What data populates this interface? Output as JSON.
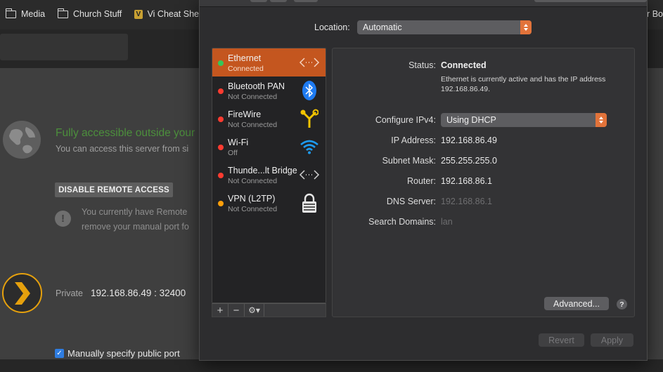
{
  "bookmarks": {
    "items": [
      {
        "label": "Media",
        "icon": "folder-icon"
      },
      {
        "label": "Church Stuff",
        "icon": "folder-icon"
      },
      {
        "label": "Vi Cheat She",
        "icon": "vi-icon"
      }
    ],
    "right_label": "or Bo"
  },
  "plex_page": {
    "remote_title": "Fully accessible outside your",
    "remote_subtitle": "You can access this server from si",
    "disable_button": "DISABLE REMOTE ACCESS",
    "warning_line1": "You currently have Remote",
    "warning_line2": "remove your manual port fo",
    "private_label": "Private",
    "private_value": "192.168.86.49 : 32400",
    "manual_port_label": "Manually specify public port",
    "manual_port_checked": true,
    "accent_color": "#e5a00d",
    "success_color": "#4c8f3c"
  },
  "network": {
    "location_label": "Location:",
    "location_value": "Automatic",
    "services": [
      {
        "name": "Ethernet",
        "status": "Connected",
        "dot": "#34c759",
        "icon": "ethernet-icon",
        "selected": true
      },
      {
        "name": "Bluetooth PAN",
        "status": "Not Connected",
        "dot": "#ff3b30",
        "icon": "bluetooth-icon",
        "selected": false
      },
      {
        "name": "FireWire",
        "status": "Not Connected",
        "dot": "#ff3b30",
        "icon": "firewire-icon",
        "selected": false
      },
      {
        "name": "Wi-Fi",
        "status": "Off",
        "dot": "#ff3b30",
        "icon": "wifi-icon",
        "selected": false
      },
      {
        "name": "Thunde...lt Bridge",
        "status": "Not Connected",
        "dot": "#ff3b30",
        "icon": "thunderbolt-bridge-icon",
        "selected": false
      },
      {
        "name": "VPN (L2TP)",
        "status": "Not Connected",
        "dot": "#ff9f0a",
        "icon": "vpn-lock-icon",
        "selected": false
      }
    ],
    "footer": {
      "add": "+",
      "remove": "−",
      "gear": "⚙▾"
    },
    "detail": {
      "status_label": "Status:",
      "status_value": "Connected",
      "status_description": "Ethernet is currently active and has the IP address 192.168.86.49.",
      "ipv4_label": "Configure IPv4:",
      "ipv4_value": "Using DHCP",
      "ip_label": "IP Address:",
      "ip_value": "192.168.86.49",
      "subnet_label": "Subnet Mask:",
      "subnet_value": "255.255.255.0",
      "router_label": "Router:",
      "router_value": "192.168.86.1",
      "dns_label": "DNS Server:",
      "dns_value": "192.168.86.1",
      "search_label": "Search Domains:",
      "search_value": "lan",
      "advanced_button": "Advanced...",
      "help_button": "?"
    },
    "revert_button": "Revert",
    "apply_button": "Apply",
    "selection_color": "#c4561f"
  }
}
